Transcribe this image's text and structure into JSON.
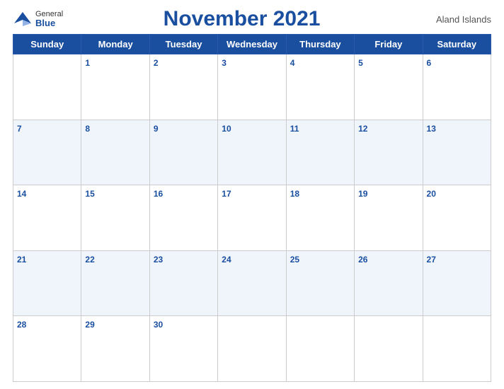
{
  "header": {
    "logo_general": "General",
    "logo_blue": "Blue",
    "title": "November 2021",
    "region": "Aland Islands"
  },
  "weekdays": [
    "Sunday",
    "Monday",
    "Tuesday",
    "Wednesday",
    "Thursday",
    "Friday",
    "Saturday"
  ],
  "weeks": [
    [
      null,
      1,
      2,
      3,
      4,
      5,
      6
    ],
    [
      7,
      8,
      9,
      10,
      11,
      12,
      13
    ],
    [
      14,
      15,
      16,
      17,
      18,
      19,
      20
    ],
    [
      21,
      22,
      23,
      24,
      25,
      26,
      27
    ],
    [
      28,
      29,
      30,
      null,
      null,
      null,
      null
    ]
  ]
}
